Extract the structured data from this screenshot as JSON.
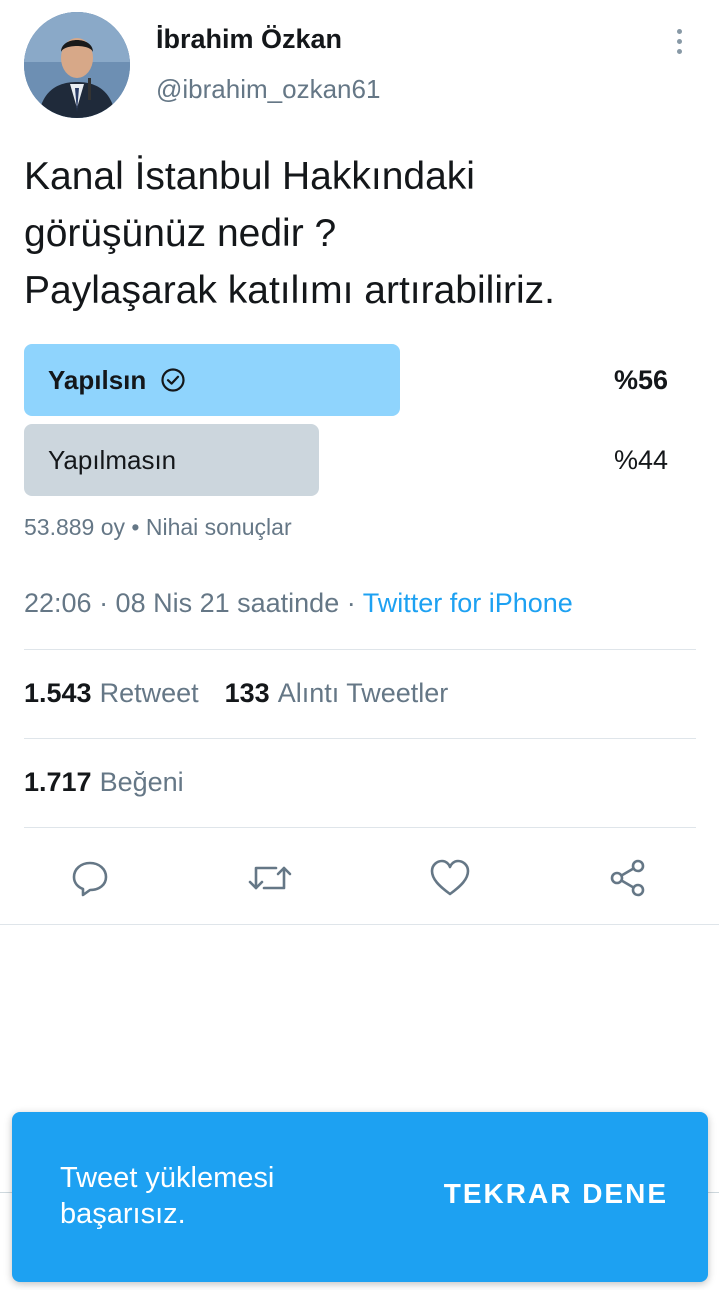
{
  "user": {
    "name": "İbrahim Özkan",
    "handle": "@ibrahim_ozkan61"
  },
  "tweet": {
    "text": "Kanal İstanbul Hakkındaki\ngörüşünüz nedir ?\nPaylaşarak katılımı artırabiliriz."
  },
  "poll": {
    "options": [
      {
        "label": "Yapılsın",
        "percent_label": "%56",
        "percent": 56,
        "winner": true
      },
      {
        "label": "Yapılmasın",
        "percent_label": "%44",
        "percent": 44,
        "winner": false
      }
    ],
    "meta": "53.889 oy • Nihai sonuçlar"
  },
  "timestamp": {
    "text": "22:06 · 08 Nis 21 saatinde · ",
    "source": "Twitter for iPhone"
  },
  "stats": {
    "retweets_count": "1.543",
    "retweets_label": "Retweet",
    "quotes_count": "133",
    "quotes_label": "Alıntı Tweetler",
    "likes_count": "1.717",
    "likes_label": "Beğeni"
  },
  "actions": [
    "reply-icon",
    "retweet-icon",
    "like-icon",
    "share-icon"
  ],
  "toast": {
    "message": "Tweet yüklemesi\nbaşarısız.",
    "button": "TEKRAR DENE"
  },
  "colors": {
    "accent": "#1da1f2",
    "poll_winner": "#8fd4fd",
    "poll_loser": "#ccd6dd",
    "secondary_text": "#657786"
  }
}
